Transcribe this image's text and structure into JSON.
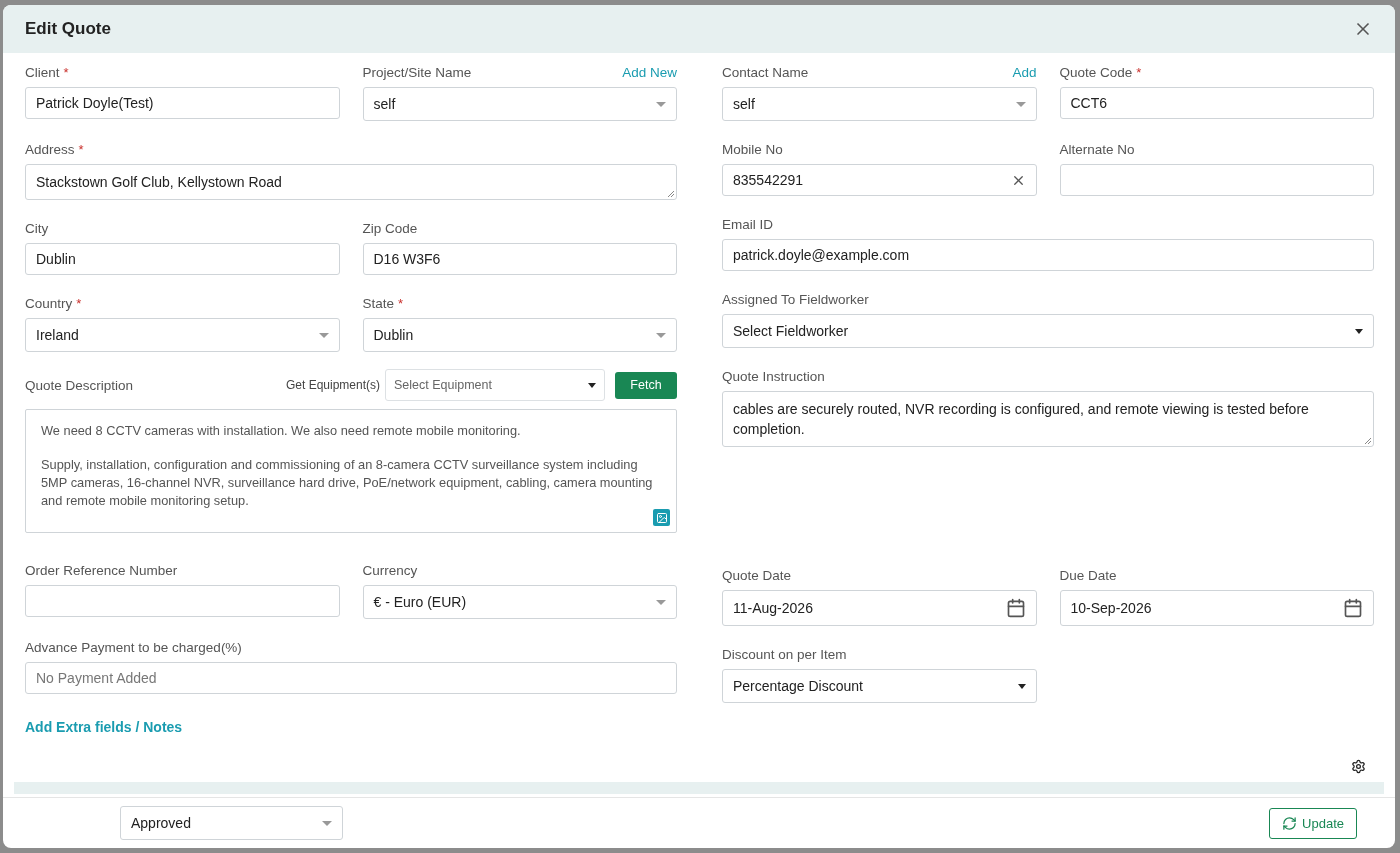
{
  "dialog": {
    "title": "Edit Quote"
  },
  "left_rows": [
    [
      {
        "kind": "input",
        "label": "Client",
        "marker": "*",
        "value": "Patrick Doyle(Test)"
      },
      {
        "kind": "select",
        "label": "Project/Site Name",
        "link": "Add New",
        "value": "self"
      }
    ],
    [
      {
        "kind": "textarea",
        "label": "Address",
        "marker": "*",
        "value": "Stackstown Golf Club, Kellystown Road",
        "wide": true
      }
    ],
    [
      {
        "kind": "input",
        "label": "City",
        "value": "Dublin"
      },
      {
        "kind": "input",
        "label": "Zip Code",
        "value": "D16 W3F6"
      }
    ],
    [
      {
        "kind": "select",
        "label": "Country",
        "marker": "*",
        "value": "Ireland"
      },
      {
        "kind": "select",
        "label": "State",
        "marker": "*",
        "value": "Dublin"
      }
    ]
  ],
  "quote_description": {
    "label": "Quote Description",
    "equipment_label": "Get Equipment(s)",
    "equipment_placeholder": "Select Equipment",
    "fetch": "Fetch",
    "paragraphs": [
      "We need 8 CCTV cameras with installation. We also need remote mobile monitoring.",
      "Supply, installation, configuration and commissioning of an 8-camera CCTV surveillance system including 5MP cameras, 16-channel NVR, surveillance hard drive, PoE/network equipment, cabling, camera mounting and remote mobile monitoring setup."
    ]
  },
  "left_rows_2": [
    [
      {
        "kind": "input",
        "label": "Order Reference Number"
      },
      {
        "kind": "select",
        "label": "Currency",
        "value": "€ - Euro (EUR)"
      }
    ],
    [
      {
        "kind": "input",
        "label": "Advance Payment to be charged(%)",
        "placeholder": "No Payment Added",
        "wide": true
      }
    ]
  ],
  "extra_link": "Add Extra fields / Notes",
  "right_rows": [
    [
      {
        "kind": "select",
        "label": "Contact Name",
        "link": "Add",
        "value": "self"
      },
      {
        "kind": "input",
        "label": "Quote Code",
        "marker": "*",
        "value": "CCT6"
      }
    ],
    [
      {
        "kind": "clearable",
        "label": "Mobile No",
        "value": "835542291"
      },
      {
        "kind": "input",
        "label": "Alternate No"
      }
    ],
    [
      {
        "kind": "input",
        "label": "Email ID",
        "value": "patrick.doyle@example.com",
        "wide": true
      }
    ],
    [
      {
        "kind": "dropdown",
        "label": "Assigned To Fieldworker",
        "value": "Select Fieldworker",
        "wide": true
      }
    ],
    [
      {
        "kind": "textarea",
        "label": "Quote Instruction",
        "value": "cables are securely routed, NVR recording is configured, and remote viewing is tested before completion.",
        "wide": true,
        "tall": true
      }
    ]
  ],
  "right_rows_2": [
    [
      {
        "kind": "date",
        "label": "Quote Date",
        "value": "11-Aug-2026"
      },
      {
        "kind": "date",
        "label": "Due Date",
        "value": "10-Sep-2026"
      }
    ],
    [
      {
        "kind": "dropdown",
        "label": "Discount on per Item",
        "value": "Percentage Discount"
      }
    ]
  ],
  "footer": {
    "status": "Approved",
    "update": "Update"
  }
}
